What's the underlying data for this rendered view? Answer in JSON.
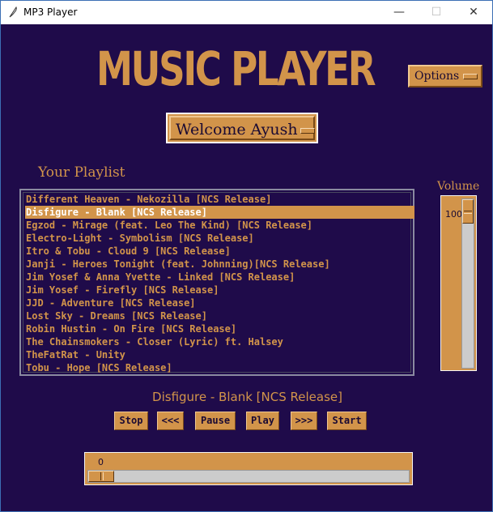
{
  "window": {
    "title": "MP3 Player",
    "icon": "feather-icon",
    "controls": {
      "minimize": "—",
      "maximize": "☐",
      "close": "✕"
    }
  },
  "header": {
    "title": "MUSIC PLAYER"
  },
  "options_menu": {
    "label": "Options"
  },
  "user_menu": {
    "label": "Welcome Ayush"
  },
  "playlist": {
    "title": "Your Playlist",
    "selected_index": 1,
    "songs": [
      "Different Heaven - Nekozilla [NCS Release]",
      "Disfigure - Blank [NCS Release]",
      "Egzod - Mirage (feat. Leo The Kind) [NCS Release]",
      "Electro-Light - Symbolism [NCS Release]",
      "Itro & Tobu - Cloud 9 [NCS Release]",
      "Janji - Heroes Tonight (feat. Johnning)[NCS Release]",
      "Jim Yosef & Anna Yvette - Linked [NCS Release]",
      "Jim Yosef - Firefly [NCS Release]",
      "JJD - Adventure [NCS Release]",
      "Lost Sky - Dreams [NCS Release]",
      "Robin Hustin - On Fire [NCS Release]",
      "The Chainsmokers - Closer (Lyric) ft. Halsey",
      "TheFatRat - Unity",
      "Tobu - Hope [NCS Release]"
    ]
  },
  "volume": {
    "label": "Volume",
    "value": "100",
    "level": 1.0
  },
  "now_playing": "Disfigure - Blank [NCS Release]",
  "controls": {
    "stop": "Stop",
    "prev": "<<<",
    "pause": "Pause",
    "play": "Play",
    "next": ">>>",
    "start": "Start"
  },
  "progress": {
    "value": "0",
    "fraction": 0.0
  },
  "colors": {
    "background": "#1f0b4a",
    "accent": "#d2944a",
    "selected_text": "#ffffff"
  }
}
